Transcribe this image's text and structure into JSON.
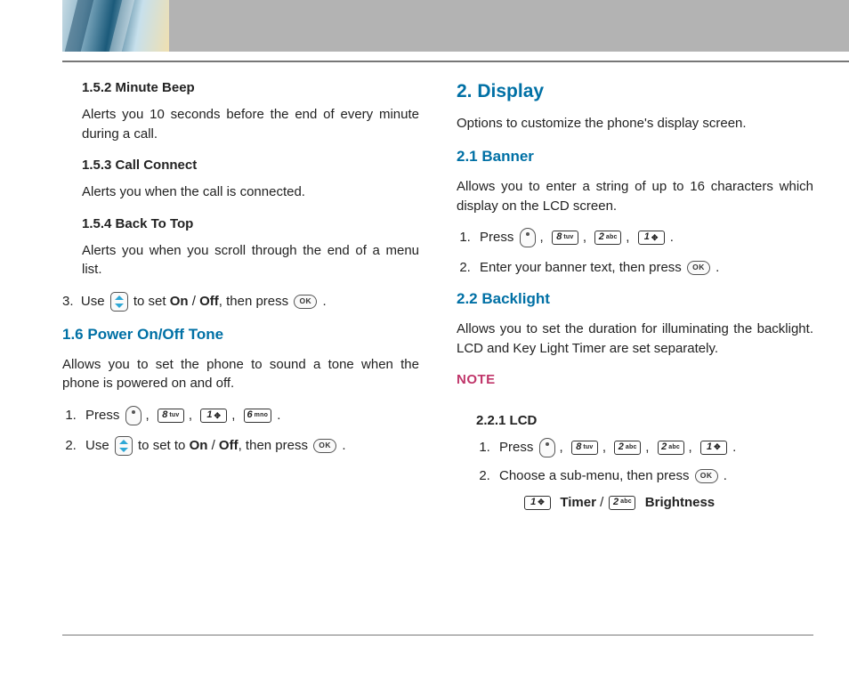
{
  "left": {
    "s152_num": "1.5.2",
    "s152_title": "Minute Beep",
    "s152_body": "Alerts you 10 seconds before the end of every minute during a call.",
    "s153_num": "1.5.3",
    "s153_title": "Call Connect",
    "s153_body": "Alerts you when the call is connected.",
    "s154_num": "1.5.4",
    "s154_title": "Back To Top",
    "s154_body": "Alerts you when you scroll through the end of a menu list.",
    "step3_start": "3.",
    "step3_a": "Use ",
    "step3_b": " to set ",
    "on": "On",
    "slash": " / ",
    "off": "Off",
    "step3_c": ", then press ",
    "period": ".",
    "s16_title": "1.6 Power On/Off Tone",
    "s16_body": "Allows you to set the phone to sound a tone when the phone is powered on and off.",
    "s16_step1": "Press ",
    "s16_step2a": "Use ",
    "s16_step2b": " to set to ",
    "s16_step2c": ", then press ",
    "comma": ", "
  },
  "right": {
    "s2_title": "2. Display",
    "s2_body": "Options to customize the phone's display screen.",
    "s21_title": "2.1 Banner",
    "s21_body": "Allows you to enter a string of up to 16 characters which display on the LCD screen.",
    "s21_step1": "Press ",
    "s21_step2a": "Enter your banner text, then press ",
    "s22_title": "2.2 Backlight",
    "s22_body": "Allows you to set the duration for illuminating the backlight. LCD and Key Light Timer are set separately.",
    "note": "NOTE",
    "s221_num": "2.2.1",
    "s221_title": "LCD",
    "s221_step1": "Press ",
    "s221_step2a": "Choose a sub-menu, then press ",
    "submenu_timer": "Timer",
    "submenu_slash": " / ",
    "submenu_bright": "Brightness"
  },
  "keys": {
    "k1_d": "1",
    "k1_s": "✥",
    "k2_d": "2",
    "k2_l": "abc",
    "k6_d": "6",
    "k6_l": "mno",
    "k8_d": "8",
    "k8_l": "tuv",
    "ok": "OK"
  }
}
